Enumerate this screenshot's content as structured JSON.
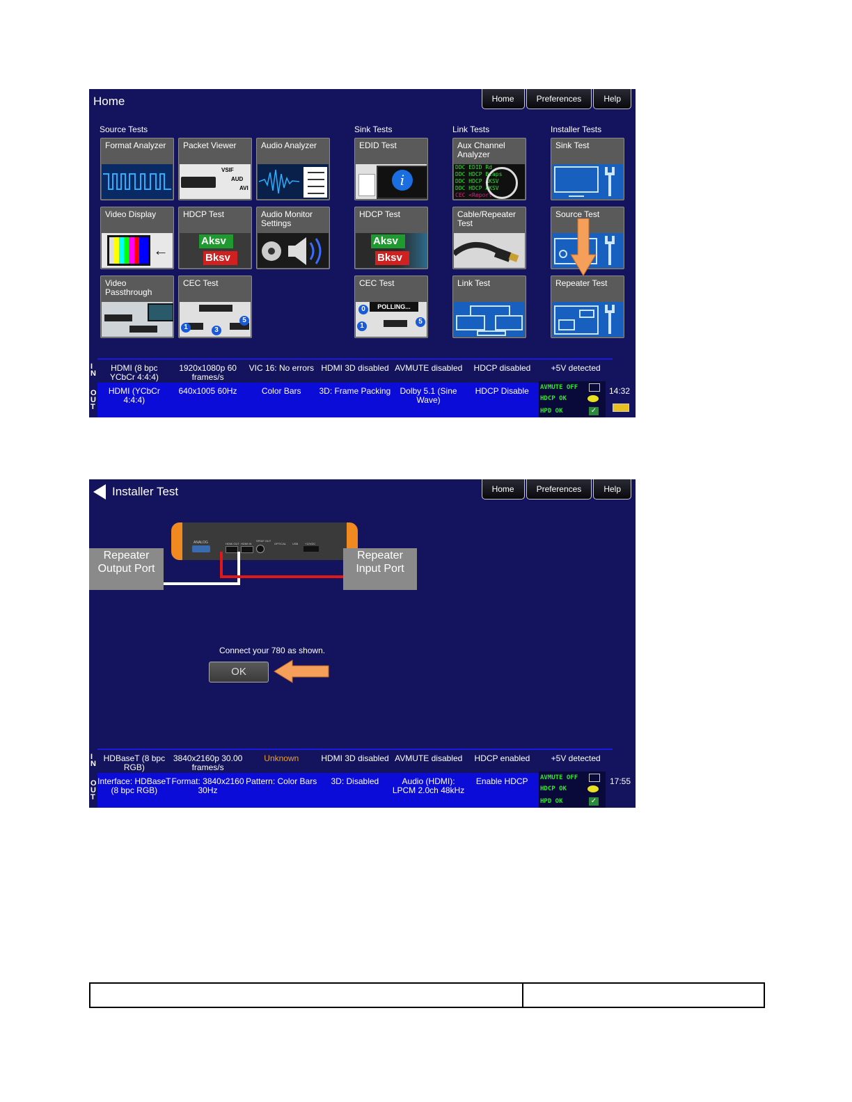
{
  "screen1": {
    "title": "Home",
    "nav": [
      "Home",
      "Preferences",
      "Help"
    ],
    "sections": {
      "source": "Source Tests",
      "sink": "Sink Tests",
      "link": "Link Tests",
      "installer": "Installer Tests"
    },
    "tiles": {
      "format_analyzer": "Format Analyzer",
      "packet_viewer": "Packet Viewer",
      "audio_analyzer": "Audio Analyzer",
      "edid_test": "EDID Test",
      "aux_channel": "Aux Channel Analyzer",
      "sink_test": "Sink Test",
      "video_display": "Video Display",
      "hdcp_test": "HDCP Test",
      "audio_monitor": "Audio Monitor Settings",
      "sink_hdcp_test": "HDCP Test",
      "cable_repeater": "Cable/Repeater Test",
      "source_test": "Source Test",
      "video_passthrough": "Video Passthrough",
      "cec_test": "CEC Test",
      "sink_cec_test": "CEC Test",
      "link_test": "Link Test",
      "repeater_test": "Repeater Test"
    },
    "tile_text": {
      "vsif": "VSIF",
      "aud": "AUD",
      "avi": "AVI",
      "aksv": "Aksv",
      "bksv": "Bksv",
      "polling": "POLLING...",
      "cec_0": "0",
      "cec_1": "1",
      "cec_3": "3",
      "cec_5": "5",
      "aux_lines": [
        "DDC EDID Rd",
        "DDC HDCP Bcaps",
        "DDC HDCP AKSV",
        "DDC HDCP AKSV",
        "CEC <Report"
      ]
    },
    "in_row": [
      "HDMI (8 bpc YCbCr 4:4:4)",
      "1920x1080p 60 frames/s",
      "VIC 16: No errors",
      "HDMI 3D disabled",
      "AVMUTE disabled",
      "HDCP disabled",
      "+5V detected"
    ],
    "out_row": [
      "HDMI (YCbCr 4:4:4)",
      "640x1005 60Hz",
      "Color Bars",
      "3D: Frame Packing",
      "Dolby 5.1 (Sine Wave)",
      "HDCP Disable"
    ],
    "status": {
      "avmute": "AVMUTE OFF",
      "hdcp": "HDCP OK",
      "hpd": "HPD OK"
    },
    "clock": "14:32",
    "in_label": [
      "I",
      "N"
    ],
    "out_label": [
      "O",
      "U",
      "T"
    ]
  },
  "screen2": {
    "title": "Installer Test",
    "nav": [
      "Home",
      "Preferences",
      "Help"
    ],
    "repeater_output": "Repeater Output Port",
    "repeater_input": "Repeater Input Port",
    "device_labels": {
      "analog": "ANALOG",
      "hdmi_out": "HDMI OUT",
      "hdmi_in": "HDMI IN",
      "spdif": "SPDIF OUT",
      "optical": "OPTICAL",
      "usb": "USB",
      "power": "+12VDC"
    },
    "instruction": "Connect your 780 as shown.",
    "ok": "OK",
    "in_row": [
      "HDBaseT (8 bpc RGB)",
      "3840x2160p 30.00 frames/s",
      "Unknown",
      "HDMI 3D disabled",
      "AVMUTE disabled",
      "HDCP enabled",
      "+5V detected"
    ],
    "out_row": [
      "Interface: HDBaseT (8 bpc RGB)",
      "Format: 3840x2160 30Hz",
      "Pattern: Color Bars",
      "3D: Disabled",
      "Audio (HDMI): LPCM 2.0ch 48kHz",
      "Enable HDCP"
    ],
    "status": {
      "avmute": "AVMUTE OFF",
      "hdcp": "HDCP OK",
      "hpd": "HPD OK"
    },
    "clock": "17:55",
    "in_label": [
      "I",
      "N"
    ],
    "out_label": [
      "O",
      "U",
      "T"
    ]
  },
  "colors": {
    "screen_bg": "#14145e",
    "status_bar": "#0c0cd8",
    "status_green": "#2fe62f",
    "unknown_text": "#f0a020",
    "orange_arrow": "#f5a05a",
    "cable_red": "#e01818"
  }
}
